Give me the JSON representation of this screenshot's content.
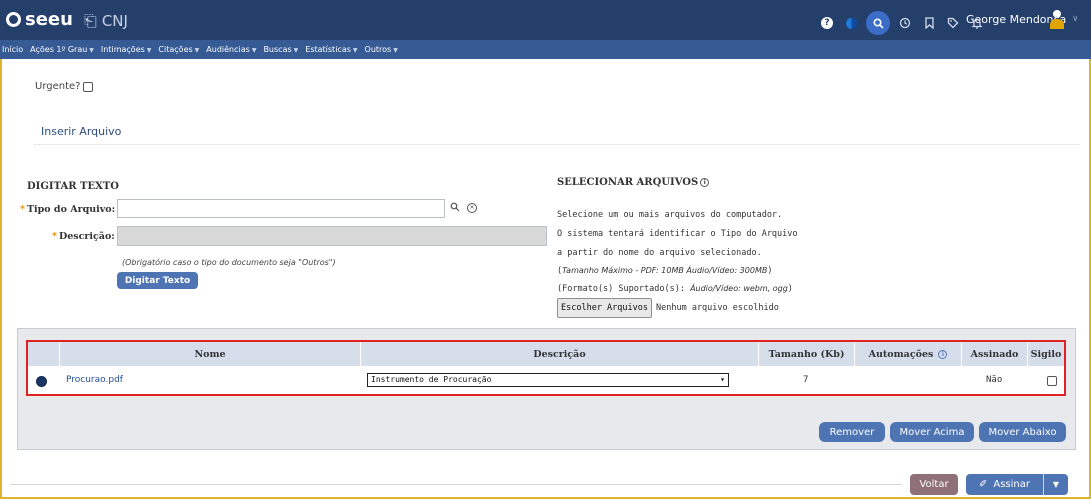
{
  "topbar": {
    "logo_text": "seeu",
    "cnj_text": "CNJ",
    "user_name": "George Mendonca",
    "help_glyph": "?",
    "colors": {
      "bar": "#253f6b",
      "menu": "#365a94",
      "accent": "#e0b32c"
    }
  },
  "menu": {
    "items": [
      {
        "label": "Início",
        "has_caret": false
      },
      {
        "label": "Ações 1º Grau",
        "has_caret": true
      },
      {
        "label": "Intimações",
        "has_caret": true
      },
      {
        "label": "Citações",
        "has_caret": true
      },
      {
        "label": "Audiências",
        "has_caret": true
      },
      {
        "label": "Buscas",
        "has_caret": true
      },
      {
        "label": "Estatísticas",
        "has_caret": true
      },
      {
        "label": "Outros",
        "has_caret": true
      }
    ]
  },
  "form": {
    "urgente_label": "Urgente?",
    "section_title": "Inserir Arquivo",
    "digitar_title": "DIGITAR TEXTO",
    "tipo_label": "Tipo do Arquivo:",
    "tipo_value": "",
    "descricao_label": "Descrição:",
    "descricao_value": "",
    "hint": "(Obrigatório caso o tipo do documento seja \"Outros\")",
    "digitar_button": "Digitar Texto"
  },
  "selecionar": {
    "title": "SELECIONAR ARQUIVOS",
    "line1": "Selecione um ou mais arquivos do computador.",
    "line2": "O sistema tentará identificar o Tipo do Arquivo",
    "line3": "a partir do nome do arquivo selecionado.",
    "line4_prefix": "(",
    "line4": "Tamanho Máximo - PDF: 10MB  Áudio/Vídeo: 300MB",
    "line4_suffix": ")",
    "line5_prefix": "(Formato(s) Suportado(s): ",
    "line5": "Áudio/Vídeo: webm, ogg",
    "line5_suffix": ")",
    "choose_button": "Escolher Arquivos",
    "no_file": "Nenhum arquivo escolhido"
  },
  "table": {
    "headers": {
      "nome": "Nome",
      "descricao": "Descrição",
      "tamanho": "Tamanho (Kb)",
      "automacoes": "Automações",
      "assinado": "Assinado",
      "sigilo": "Sigilo"
    },
    "rows": [
      {
        "nome": "Procurao.pdf",
        "descricao": "Instrumento de Procuração",
        "tamanho": "7",
        "automacoes": "",
        "assinado": "Não",
        "sigilo": false
      }
    ]
  },
  "actions": {
    "remover": "Remover",
    "mover_acima": "Mover Acima",
    "mover_abaixo": "Mover Abaixo"
  },
  "footer": {
    "voltar": "Voltar",
    "assinar": "Assinar"
  }
}
